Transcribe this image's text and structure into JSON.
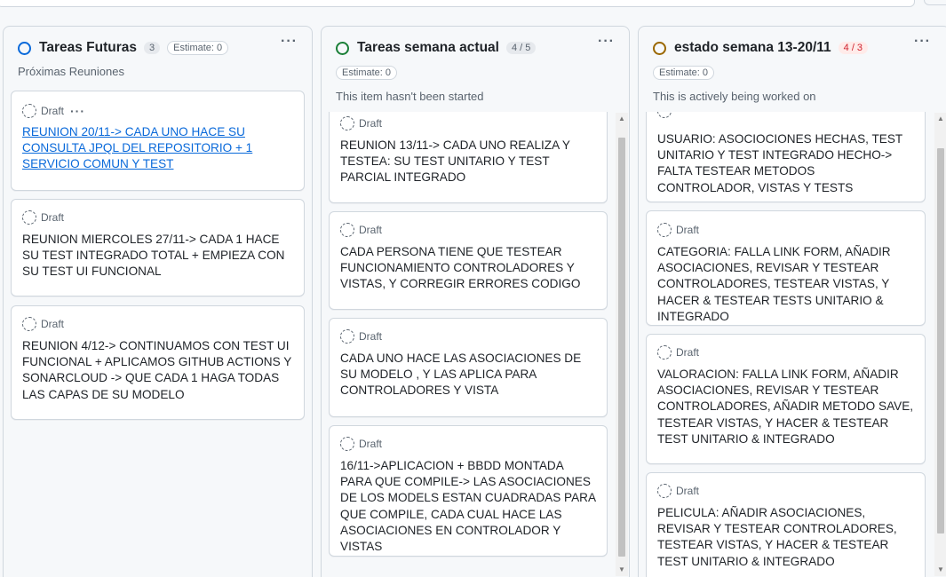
{
  "colors": {
    "todo_circle": "#0969da",
    "in_progress_circle": "#1a7f37",
    "done_circle": "#9a6700",
    "link": "#0969da",
    "over_limit": "#cf222e"
  },
  "columns": [
    {
      "title": "Tareas Futuras",
      "count": "3",
      "estimate": "Estimate: 0",
      "description": "Próximas Reuniones",
      "status_icon": "open-circle-icon",
      "menu_glyph": "···",
      "cards": [
        {
          "draft_label": "Draft",
          "menu_glyph": "···",
          "text": "REUNION 20/11-> CADA UNO HACE SU CONSULTA JPQL DEL REPOSITORIO + 1 SERVICIO COMUN Y TEST",
          "is_link": true
        },
        {
          "draft_label": "Draft",
          "text": "REUNION MIERCOLES 27/11-> CADA 1 HACE SU TEST INTEGRADO TOTAL + EMPIEZA CON SU TEST UI FUNCIONAL"
        },
        {
          "draft_label": "Draft",
          "text": "REUNION 4/12-> CONTINUAMOS CON TEST UI FUNCIONAL + APLICAMOS GITHUB ACTIONS Y SONARCLOUD -> QUE CADA 1 HAGA TODAS LAS CAPAS DE SU MODELO"
        }
      ]
    },
    {
      "title": "Tareas semana actual",
      "count": "4 / 5",
      "estimate": "Estimate: 0",
      "description": "This item hasn't been started",
      "status_icon": "open-circle-icon",
      "menu_glyph": "···",
      "cards": [
        {
          "draft_label": "Draft",
          "text": "REUNION 13/11-> CADA UNO REALIZA Y TESTEA: SU TEST UNITARIO Y TEST PARCIAL INTEGRADO"
        },
        {
          "draft_label": "Draft",
          "text": "CADA PERSONA TIENE QUE TESTEAR FUNCIONAMIENTO CONTROLADORES Y VISTAS, Y CORREGIR ERRORES CODIGO"
        },
        {
          "draft_label": "Draft",
          "text": "CADA UNO HACE LAS ASOCIACIONES DE SU MODELO , Y LAS APLICA PARA CONTROLADORES Y VISTA"
        },
        {
          "draft_label": "Draft",
          "text": "16/11->APLICACION + BBDD MONTADA PARA QUE COMPILE-> LAS ASOCIACIONES DE LOS MODELS ESTAN CUADRADAS PARA QUE COMPILE, CADA CUAL HACE LAS ASOCIACIONES EN CONTROLADOR Y VISTAS"
        }
      ]
    },
    {
      "title": "estado semana 13-20/11",
      "count": "4 / 3",
      "estimate": "Estimate: 0",
      "description": "This is actively being worked on",
      "status_icon": "open-circle-icon",
      "menu_glyph": "···",
      "cards": [
        {
          "draft_label": "",
          "text": "USUARIO: ASOCIOCIONES HECHAS, TEST UNITARIO Y TEST INTEGRADO HECHO-> FALTA TESTEAR METODOS CONTROLADOR, VISTAS Y TESTS"
        },
        {
          "draft_label": "Draft",
          "text": "CATEGORIA: FALLA LINK FORM, AÑADIR ASOCIACIONES, REVISAR Y TESTEAR CONTROLADORES, TESTEAR VISTAS, Y HACER & TESTEAR TESTS UNITARIO & INTEGRADO"
        },
        {
          "draft_label": "Draft",
          "text": "VALORACION: FALLA LINK FORM, AÑADIR ASOCIACIONES, REVISAR Y TESTEAR CONTROLADORES, AÑADIR METODO SAVE, TESTEAR VISTAS, Y HACER & TESTEAR TEST UNITARIO & INTEGRADO"
        },
        {
          "draft_label": "Draft",
          "text": "PELICULA: AÑADIR ASOCIACIONES, REVISAR Y TESTEAR CONTROLADORES, TESTEAR VISTAS, Y HACER & TESTEAR TEST UNITARIO & INTEGRADO"
        }
      ]
    }
  ]
}
